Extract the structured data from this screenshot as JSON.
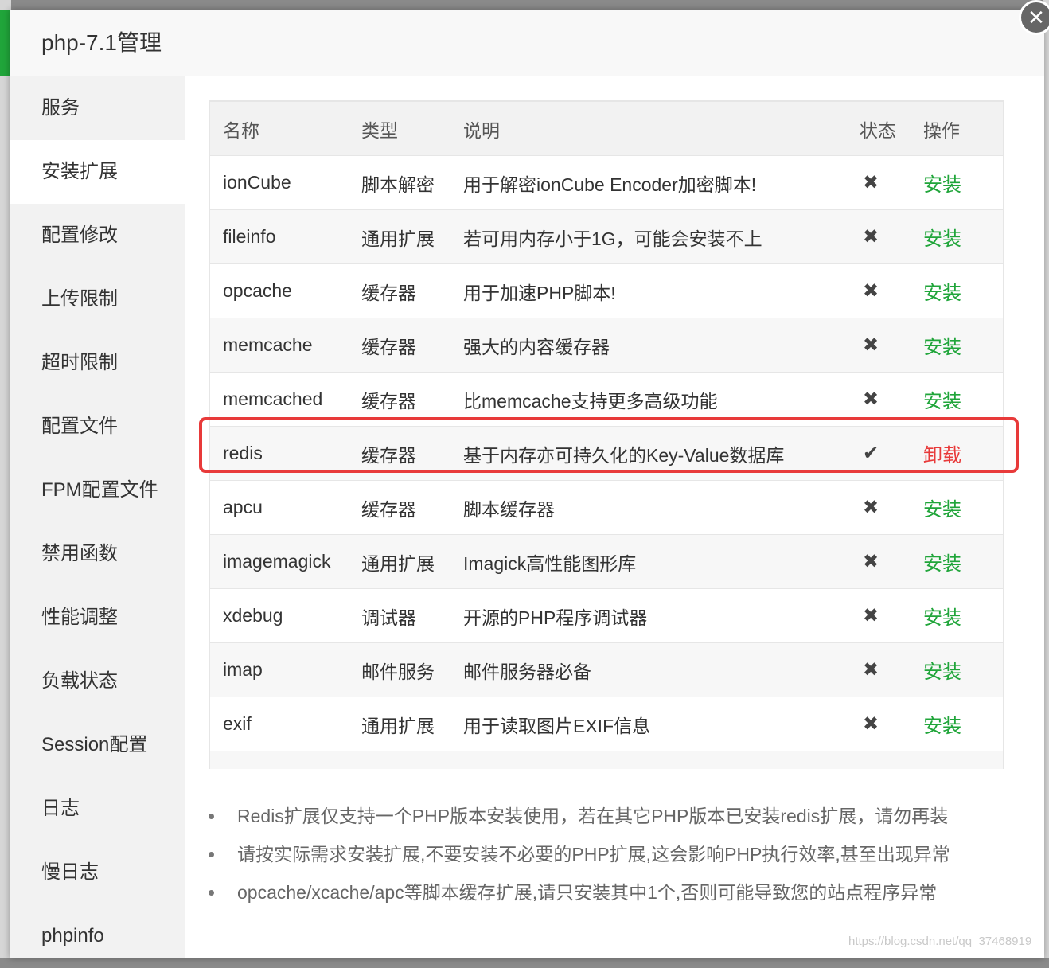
{
  "dialog": {
    "title": "php-7.1管理",
    "close_icon": "close-icon"
  },
  "sidebar": {
    "items": [
      {
        "label": "服务"
      },
      {
        "label": "安装扩展",
        "active": true
      },
      {
        "label": "配置修改"
      },
      {
        "label": "上传限制"
      },
      {
        "label": "超时限制"
      },
      {
        "label": "配置文件"
      },
      {
        "label": "FPM配置文件"
      },
      {
        "label": "禁用函数"
      },
      {
        "label": "性能调整"
      },
      {
        "label": "负载状态"
      },
      {
        "label": "Session配置"
      },
      {
        "label": "日志"
      },
      {
        "label": "慢日志"
      },
      {
        "label": "phpinfo"
      }
    ]
  },
  "table": {
    "headers": {
      "name": "名称",
      "type": "类型",
      "desc": "说明",
      "status": "状态",
      "op": "操作"
    },
    "rows": [
      {
        "name": "ionCube",
        "type": "脚本解密",
        "desc": "用于解密ionCube Encoder加密脚本!",
        "status": "✖",
        "op": "安装",
        "installed": false
      },
      {
        "name": "fileinfo",
        "type": "通用扩展",
        "desc": "若可用内存小于1G，可能会安装不上",
        "status": "✖",
        "op": "安装",
        "installed": false
      },
      {
        "name": "opcache",
        "type": "缓存器",
        "desc": "用于加速PHP脚本!",
        "status": "✖",
        "op": "安装",
        "installed": false
      },
      {
        "name": "memcache",
        "type": "缓存器",
        "desc": "强大的内容缓存器",
        "status": "✖",
        "op": "安装",
        "installed": false
      },
      {
        "name": "memcached",
        "type": "缓存器",
        "desc": "比memcache支持更多高级功能",
        "status": "✖",
        "op": "安装",
        "installed": false
      },
      {
        "name": "redis",
        "type": "缓存器",
        "desc": "基于内存亦可持久化的Key-Value数据库",
        "status": "✔",
        "op": "卸载",
        "installed": true
      },
      {
        "name": "apcu",
        "type": "缓存器",
        "desc": "脚本缓存器",
        "status": "✖",
        "op": "安装",
        "installed": false
      },
      {
        "name": "imagemagick",
        "type": "通用扩展",
        "desc": "Imagick高性能图形库",
        "status": "✖",
        "op": "安装",
        "installed": false
      },
      {
        "name": "xdebug",
        "type": "调试器",
        "desc": "开源的PHP程序调试器",
        "status": "✖",
        "op": "安装",
        "installed": false
      },
      {
        "name": "imap",
        "type": "邮件服务",
        "desc": "邮件服务器必备",
        "status": "✖",
        "op": "安装",
        "installed": false
      },
      {
        "name": "exif",
        "type": "通用扩展",
        "desc": "用于读取图片EXIF信息",
        "status": "✖",
        "op": "安装",
        "installed": false
      },
      {
        "name": "",
        "type": "",
        "desc": "",
        "status": "",
        "op": "",
        "installed": false
      }
    ]
  },
  "notes": [
    "Redis扩展仅支持一个PHP版本安装使用，若在其它PHP版本已安装redis扩展，请勿再装",
    "请按实际需求安装扩展,不要安装不必要的PHP扩展,这会影响PHP执行效率,甚至出现异常",
    "opcache/xcache/apc等脚本缓存扩展,请只安装其中1个,否则可能导致您的站点程序异常"
  ],
  "watermark": "https://blog.csdn.net/qq_37468919",
  "colors": {
    "install": "#20a53a",
    "uninstall": "#e83a3a",
    "highlight": "#e83a3a"
  }
}
